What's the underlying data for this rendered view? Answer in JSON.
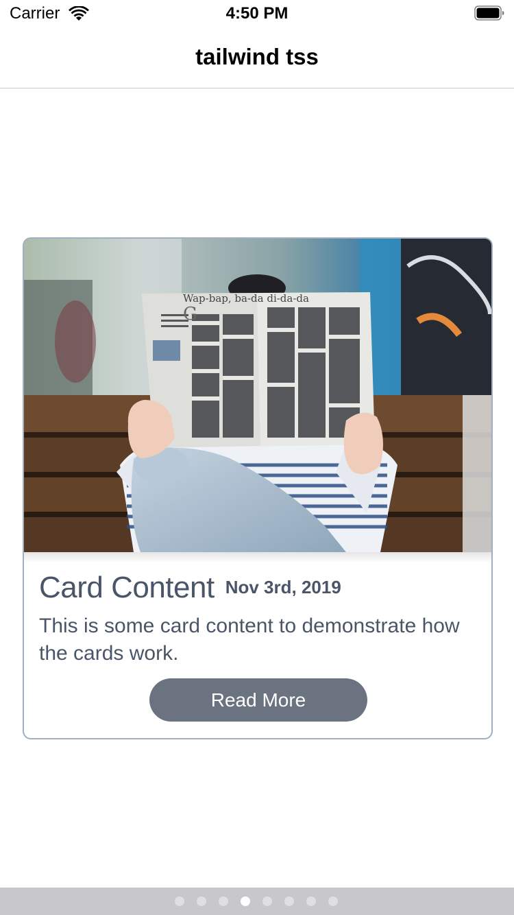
{
  "status_bar": {
    "carrier": "Carrier",
    "time": "4:50 PM"
  },
  "nav": {
    "title": "tailwind tss"
  },
  "card": {
    "image_alt": "person reading a newspaper on a wooden bench",
    "image_headline": "Wap-bap, ba-da di-da-da",
    "title": "Card Content",
    "date": "Nov 3rd, 2019",
    "body": "This is some card content to demonstrate how the cards work.",
    "button_label": "Read More",
    "border_color": "#a0aec0",
    "text_color": "#4a5568",
    "button_color": "#6b7280"
  },
  "pager": {
    "total_pages": 8,
    "current_page": 4
  },
  "icons": {
    "wifi": "wifi-icon",
    "battery": "battery-icon"
  }
}
